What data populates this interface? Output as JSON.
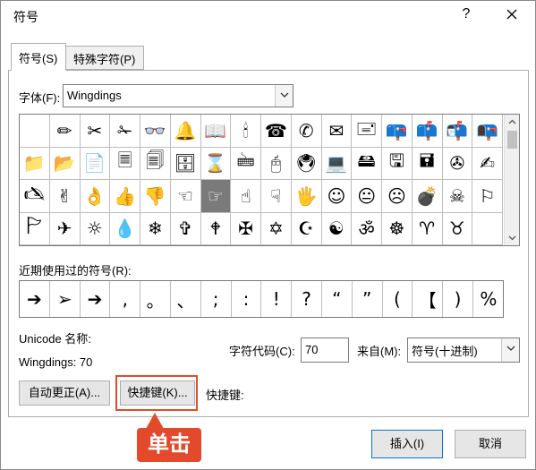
{
  "window": {
    "title": "符号",
    "help_label": "?"
  },
  "tabs": [
    {
      "label": "符号(S)"
    },
    {
      "label": "特殊字符(P)"
    }
  ],
  "font": {
    "label": "字体(F):",
    "value": "Wingdings"
  },
  "symbol_grid": {
    "rows": [
      [
        " ",
        "✏",
        "✂",
        "✁",
        "👓",
        "🔔",
        "📖",
        "🕯",
        "☎",
        "✆",
        "✉",
        "🖃",
        "📪",
        "📫",
        "📬",
        "📭"
      ],
      [
        "📁",
        "📂",
        "📄",
        "🗏",
        "🗐",
        "🗄",
        "⌛",
        "🖮",
        "🖰",
        "🖲",
        "💻",
        "🖴",
        "🖫",
        "🖬",
        "✇",
        "✍"
      ],
      [
        "🖎",
        "✌",
        "👌",
        "👍",
        "👎",
        "☜",
        "☞",
        "☝",
        "☟",
        "🖐",
        "☺",
        "😐",
        "☹",
        "💣",
        "☠",
        "⚐"
      ],
      [
        "🏱",
        "✈",
        "☼",
        "💧",
        "❄",
        "✞",
        "🕈",
        "✠",
        "✡",
        "☪",
        "☯",
        "ॐ",
        "☸",
        "♈",
        "♉",
        " "
      ]
    ],
    "selected": {
      "row": 2,
      "col": 6
    }
  },
  "recent": {
    "label": "近期使用过的符号(R):",
    "items": [
      "➔",
      "➢",
      "➔",
      ",",
      "。",
      "、",
      ";",
      ":",
      "!",
      "?",
      "“",
      "”",
      "(",
      "【",
      ")",
      "%"
    ]
  },
  "unicode_name_label": "Unicode 名称:",
  "char_name": "Wingdings: 70",
  "char_code": {
    "label": "字符代码(C):",
    "value": "70"
  },
  "from": {
    "label": "来自(M):",
    "value": "符号(十进制)"
  },
  "buttons": {
    "autocorrect": "自动更正(A)...",
    "shortcut_key": "快捷键(K)...",
    "shortcut_label": "快捷键:",
    "insert": "插入(I)",
    "cancel": "取消"
  },
  "annotation": {
    "text": "单击",
    "color": "#e24a2b"
  }
}
